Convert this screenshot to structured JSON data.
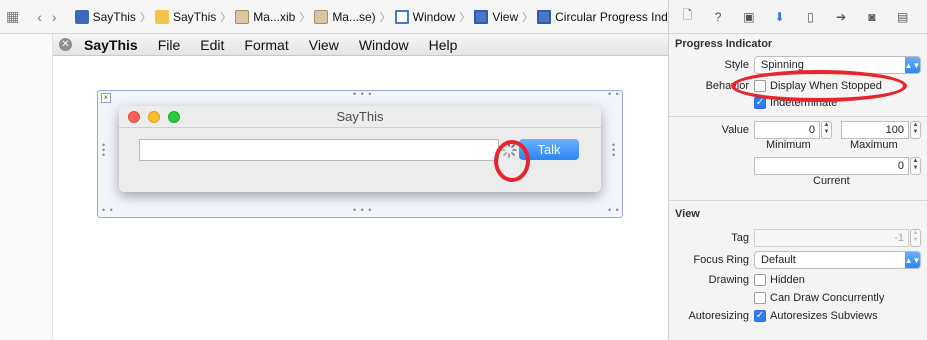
{
  "breadcrumb": [
    {
      "label": "SayThis",
      "icon": "swift-file-icon"
    },
    {
      "label": "SayThis",
      "icon": "folder-icon"
    },
    {
      "label": "Ma...xib",
      "icon": "xib-file-icon"
    },
    {
      "label": "Ma...se)",
      "icon": "xib-file-icon"
    },
    {
      "label": "Window",
      "icon": "window-icon"
    },
    {
      "label": "View",
      "icon": "view-icon"
    },
    {
      "label": "Circular Progress Indicator",
      "icon": "view-icon"
    }
  ],
  "menubar": {
    "app": "SayThis",
    "items": [
      "File",
      "Edit",
      "Format",
      "View",
      "Window",
      "Help"
    ]
  },
  "window": {
    "title": "SayThis",
    "talk_label": "Talk"
  },
  "inspector": {
    "progress_section": "Progress Indicator",
    "style_label": "Style",
    "style_value": "Spinning",
    "behavior_label": "Behavior",
    "display_when_stopped": "Display When Stopped",
    "indeterminate": "Indeterminate",
    "value_label": "Value",
    "minimum_value": "0",
    "maximum_value": "100",
    "minimum_label": "Minimum",
    "maximum_label": "Maximum",
    "current_value": "0",
    "current_label": "Current",
    "view_section": "View",
    "tag_label": "Tag",
    "tag_value": "-1",
    "focus_ring_label": "Focus Ring",
    "focus_ring_value": "Default",
    "drawing_label": "Drawing",
    "hidden_label": "Hidden",
    "can_draw_label": "Can Draw Concurrently",
    "autoresizing_label": "Autoresizing",
    "autoresizes_label": "Autoresizes Subviews"
  },
  "colors": {
    "accent": "#2f7df6",
    "annotation": "#e8242d"
  }
}
